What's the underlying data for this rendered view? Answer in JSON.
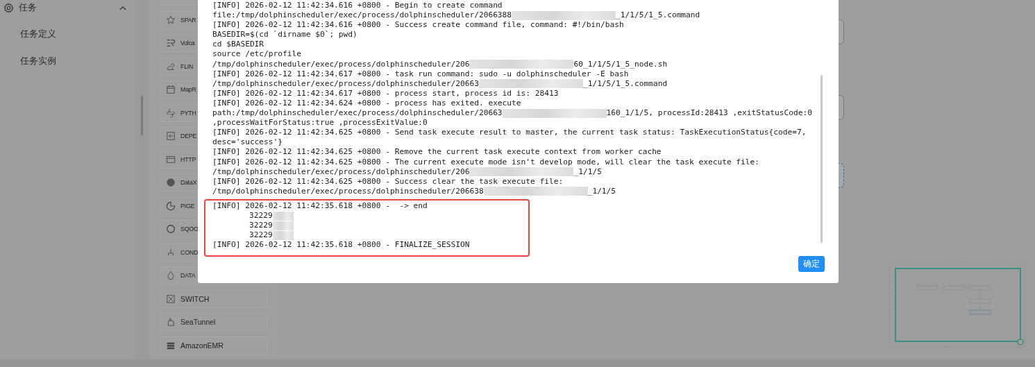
{
  "sidebar": {
    "section": {
      "title": "任务",
      "expanded": true
    },
    "items": [
      {
        "label": "任务定义",
        "selected": false
      },
      {
        "label": "任务实例",
        "selected": false
      }
    ]
  },
  "palette": [
    {
      "label": "SPAR"
    },
    {
      "label": "Volca"
    },
    {
      "label": "FLIN"
    },
    {
      "label": "MapR"
    },
    {
      "label": "PYTH"
    },
    {
      "label": "DEPE"
    },
    {
      "label": "HTTP"
    },
    {
      "label": "DataX"
    },
    {
      "label": "PIGE"
    },
    {
      "label": "SQOO"
    },
    {
      "label": "COND"
    },
    {
      "label": "DATA"
    },
    {
      "label": "SWITCH"
    },
    {
      "label": "SeaTunnel"
    },
    {
      "label": "AmazonEMR"
    }
  ],
  "canvas": {
    "nodes": [
      {
        "selected": false
      },
      {
        "selected": false
      },
      {
        "selected": true
      }
    ]
  },
  "log_dialog": {
    "lines": [
      [
        {
          "kind": "text",
          "text": "[INFO] 2026-02-12 11:42:34.616 +0800 - Begin to create command"
        }
      ],
      [
        {
          "kind": "text",
          "text": "file:/tmp/dolphinscheduler/exec/process/dolphinscheduler/2066388"
        },
        {
          "kind": "blur"
        },
        {
          "kind": "text",
          "text": "_1/1/5/1_5.command"
        }
      ],
      [
        {
          "kind": "text",
          "text": "[INFO] 2026-02-12 11:42:34.616 +0800 - Success create command file, command: #!/bin/bash"
        }
      ],
      [
        {
          "kind": "text",
          "text": "BASEDIR=$(cd `dirname $0`; pwd)"
        }
      ],
      [
        {
          "kind": "text",
          "text": "cd $BASEDIR"
        }
      ],
      [
        {
          "kind": "text",
          "text": "source /etc/profile"
        }
      ],
      [
        {
          "kind": "text",
          "text": "/tmp/dolphinscheduler/exec/process/dolphinscheduler/206"
        },
        {
          "kind": "blur"
        },
        {
          "kind": "text",
          "text": "60_1/1/5/1_5_node.sh"
        }
      ],
      [
        {
          "kind": "text",
          "text": "[INFO] 2026-02-12 11:42:34.617 +0800 - task run command: sudo -u dolphinscheduler -E bash"
        }
      ],
      [
        {
          "kind": "text",
          "text": "/tmp/dolphinscheduler/exec/process/dolphinscheduler/20663"
        },
        {
          "kind": "blur"
        },
        {
          "kind": "text",
          "text": "_1/1/5/1_5.command"
        }
      ],
      [
        {
          "kind": "text",
          "text": "[INFO] 2026-02-12 11:42:34.617 +0800 - process start, process id is: 28413"
        }
      ],
      [
        {
          "kind": "text",
          "text": "[INFO] 2026-02-12 11:42:34.624 +0800 - process has exited. execute"
        }
      ],
      [
        {
          "kind": "text",
          "text": "path:/tmp/dolphinscheduler/exec/process/dolphinscheduler/20663"
        },
        {
          "kind": "blur"
        },
        {
          "kind": "text",
          "text": "160_1/1/5, processId:28413 ,exitStatusCode:0"
        }
      ],
      [
        {
          "kind": "text",
          "text": ",processWaitForStatus:true ,processExitValue:0"
        }
      ],
      [
        {
          "kind": "text",
          "text": "[INFO] 2026-02-12 11:42:34.625 +0800 - Send task execute result to master, the current task status: TaskExecutionStatus{code=7,"
        }
      ],
      [
        {
          "kind": "text",
          "text": "desc='success'}"
        }
      ],
      [
        {
          "kind": "text",
          "text": "[INFO] 2026-02-12 11:42:34.625 +0800 - Remove the current task execute context from worker cache"
        }
      ],
      [
        {
          "kind": "text",
          "text": "[INFO] 2026-02-12 11:42:34.625 +0800 - The current execute mode isn't develop mode, will clear the task execute file:"
        }
      ],
      [
        {
          "kind": "text",
          "text": "/tmp/dolphinscheduler/exec/process/dolphinscheduler/206"
        },
        {
          "kind": "blur"
        },
        {
          "kind": "text",
          "text": "_1/1/5"
        }
      ],
      [
        {
          "kind": "text",
          "text": "[INFO] 2026-02-12 11:42:34.625 +0800 - Success clear the task execute file:"
        }
      ],
      [
        {
          "kind": "text",
          "text": "/tmp/dolphinscheduler/exec/process/dolphinscheduler/206638"
        },
        {
          "kind": "blur"
        },
        {
          "kind": "text",
          "text": "_1/1/5"
        }
      ]
    ],
    "highlight": {
      "lines": [
        {
          "indented": false,
          "segments": [
            {
              "kind": "text",
              "text": "[INFO] 2026-02-12 11:42:35.618 +0800 -  -> end"
            }
          ]
        },
        {
          "indented": true,
          "segments": [
            {
              "kind": "text",
              "text": "32229"
            },
            {
              "kind": "blur-short"
            }
          ]
        },
        {
          "indented": true,
          "segments": [
            {
              "kind": "text",
              "text": "32229"
            },
            {
              "kind": "blur-short"
            }
          ]
        },
        {
          "indented": true,
          "segments": [
            {
              "kind": "text",
              "text": "32229"
            },
            {
              "kind": "blur-short"
            }
          ]
        },
        {
          "indented": false,
          "segments": [
            {
              "kind": "text",
              "text": "[INFO] 2026-02-12 11:42:35.618 +0800 - FINALIZE_SESSION"
            }
          ]
        }
      ]
    },
    "confirm_button": "确定"
  }
}
